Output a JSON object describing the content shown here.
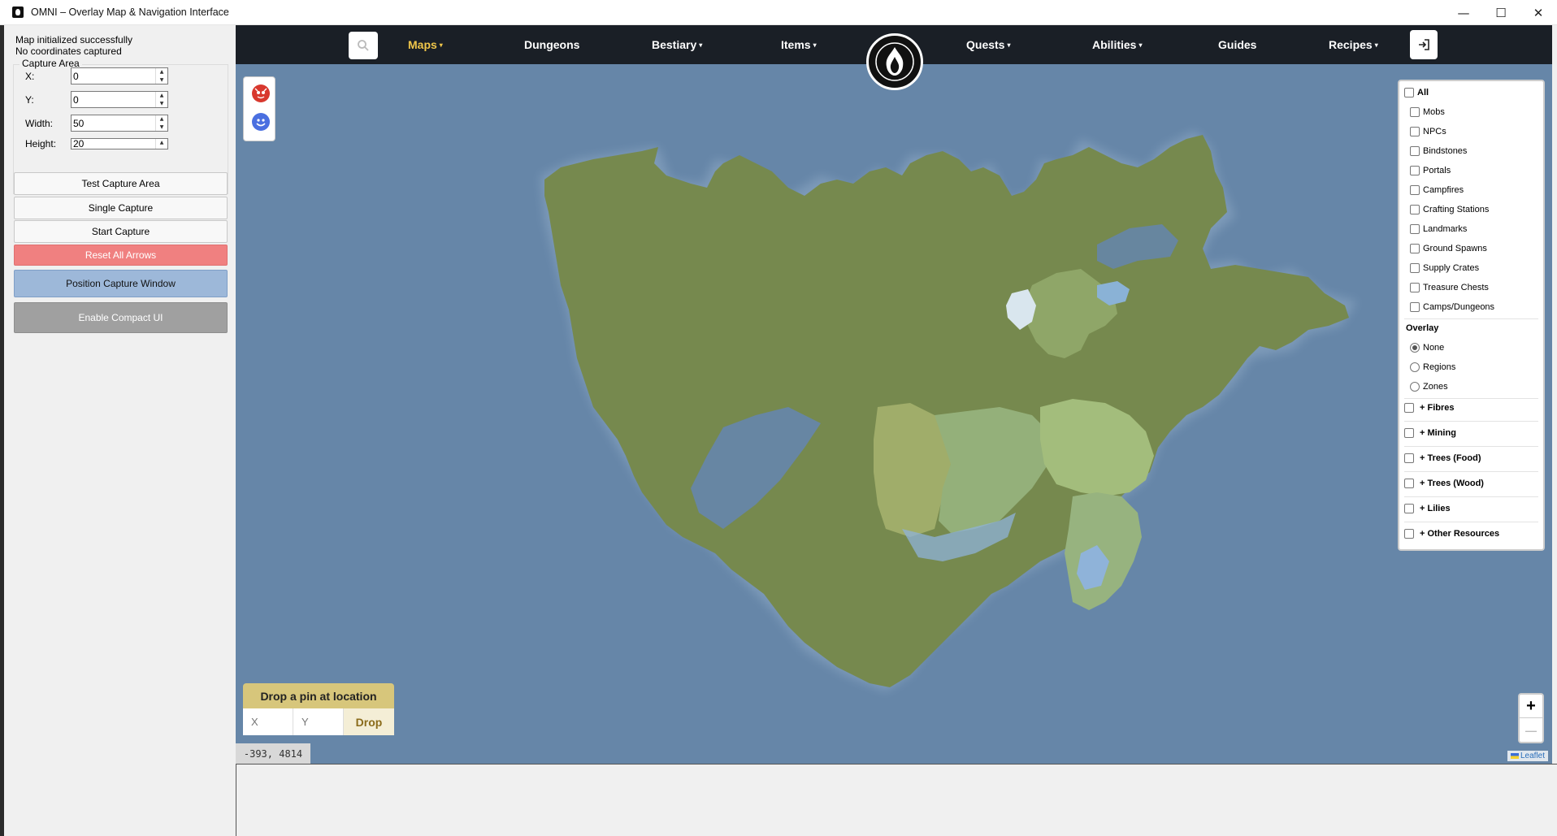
{
  "window": {
    "title": "OMNI – Overlay Map & Navigation Interface",
    "controls": [
      "—",
      "☐",
      "✕"
    ]
  },
  "left_panel": {
    "status_lines": [
      "Map initialized successfully",
      "No coordinates captured"
    ],
    "capture_group_title": "Capture Area",
    "fields": [
      {
        "label": "X:",
        "value": "0"
      },
      {
        "label": "Y:",
        "value": "0"
      },
      {
        "label": "Width:",
        "value": "50"
      },
      {
        "label": "Height:",
        "value": "20"
      }
    ],
    "buttons": {
      "test": "Test Capture Area",
      "single": "Single Capture",
      "start": "Start Capture",
      "reset": "Reset All Arrows",
      "position": "Position Capture Window",
      "compact": "Enable Compact UI"
    }
  },
  "nav": {
    "search_icon": "search-icon",
    "items": [
      {
        "label": "Maps",
        "dropdown": true,
        "active": true
      },
      {
        "label": "Dungeons",
        "dropdown": false
      },
      {
        "label": "Bestiary",
        "dropdown": true
      },
      {
        "label": "Items",
        "dropdown": true
      },
      {
        "label": "Quests",
        "dropdown": true
      },
      {
        "label": "Abilities",
        "dropdown": true
      },
      {
        "label": "Guides",
        "dropdown": false
      },
      {
        "label": "Recipes",
        "dropdown": true
      }
    ],
    "caret": "▾",
    "logo_icon": "flame-logo-icon",
    "login_icon": "login-icon"
  },
  "filters": {
    "all": "All",
    "categories": [
      "Mobs",
      "NPCs",
      "Bindstones",
      "Portals",
      "Campfires",
      "Crafting Stations",
      "Landmarks",
      "Ground Spawns",
      "Supply Crates",
      "Treasure Chests",
      "Camps/Dungeons"
    ],
    "overlay_title": "Overlay",
    "overlay_options": [
      "None",
      "Regions",
      "Zones"
    ],
    "overlay_selected": "None",
    "resource_groups": [
      "+ Fibres",
      "+ Mining",
      "+ Trees (Food)",
      "+ Trees (Wood)",
      "+ Lilies",
      "+ Other Resources"
    ]
  },
  "pin": {
    "title": "Drop a pin at location",
    "x_placeholder": "X",
    "y_placeholder": "Y",
    "drop": "Drop"
  },
  "coords": "-393, 4814",
  "zoom": {
    "in": "+",
    "out": "—"
  },
  "attribution": "Leaflet",
  "colors": {
    "ocean": "#6686a8",
    "land": "#76894e",
    "nav_bg": "#1a1f26",
    "nav_active": "#f0c64a"
  }
}
